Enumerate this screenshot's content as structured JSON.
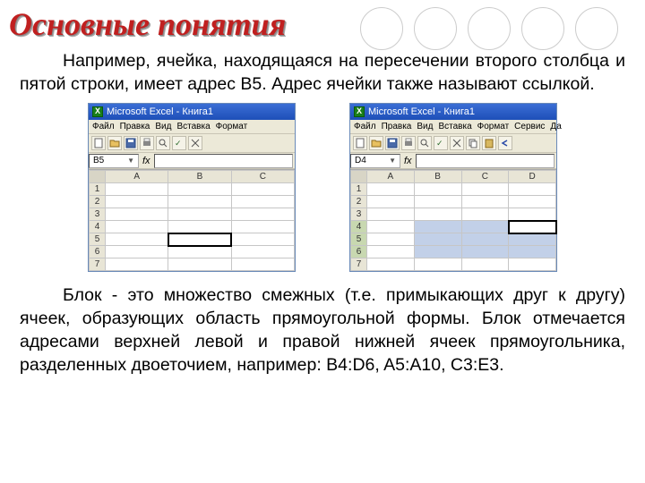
{
  "title": "Основные понятия",
  "paragraph1": "Например, ячейка, находящаяся на пересечении второго столбца и пятой строки, имеет адрес B5. Адрес ячейки также называют ссылкой.",
  "paragraph2": "Блок - это множество смежных (т.е. примыкающих друг к другу) ячеек, образующих область прямоугольной формы. Блок отмечается адресами верхней левой и правой нижней ячеек прямоугольника, разделенных двоеточием, например: B4:D6, A5:A10, C3:E3.",
  "excel_left": {
    "titlebar": "Microsoft Excel - Книга1",
    "menu": [
      "Файл",
      "Правка",
      "Вид",
      "Вставка",
      "Формат"
    ],
    "namebox": "B5",
    "cols": [
      "A",
      "B",
      "C"
    ],
    "rows": [
      "1",
      "2",
      "3",
      "4",
      "5",
      "6",
      "7"
    ],
    "selected_cell": "B5"
  },
  "excel_right": {
    "titlebar": "Microsoft Excel - Книга1",
    "menu": [
      "Файл",
      "Правка",
      "Вид",
      "Вставка",
      "Формат",
      "Сервис",
      "Да"
    ],
    "namebox": "D4",
    "cols": [
      "A",
      "B",
      "C",
      "D"
    ],
    "rows": [
      "1",
      "2",
      "3",
      "4",
      "5",
      "6",
      "7"
    ],
    "selected_range": "B4:D6",
    "active_cell": "D4"
  }
}
